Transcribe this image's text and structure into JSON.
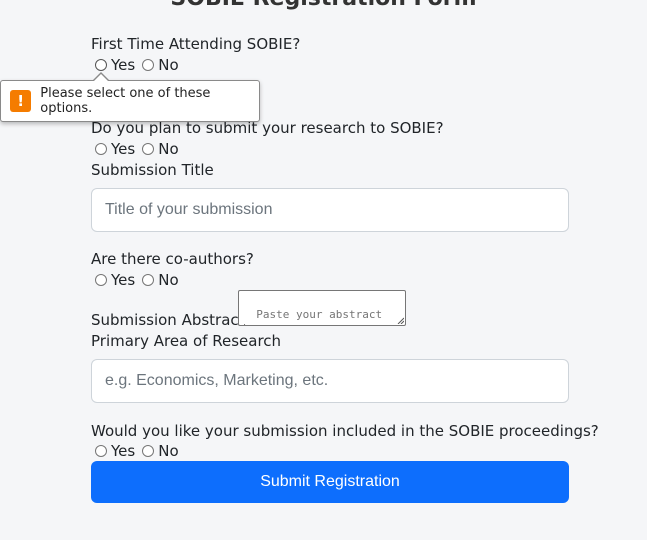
{
  "form": {
    "title": "SOBIE Registration Form",
    "q_first_time": "First Time Attending SOBIE?",
    "q_submit_research": "Do you plan to submit your research to SOBIE?",
    "submission_title_label": "Submission Title",
    "submission_title_placeholder": "Title of your submission",
    "q_coauthors": "Are there co-authors?",
    "abstract_label": "Submission Abstract",
    "abstract_placeholder": "Paste your abstract here...",
    "primary_area_label": "Primary Area of Research",
    "primary_area_placeholder": "e.g. Economics, Marketing, etc.",
    "q_proceedings": "Would you like your submission included in the SOBIE proceedings?",
    "yes": "Yes",
    "no": "No",
    "submit_label": "Submit Registration"
  },
  "validation": {
    "message": "Please select one of these options.",
    "icon": "exclamation-icon",
    "icon_glyph": "!"
  },
  "colors": {
    "primary": "#0d6efd",
    "warning": "#f57c00",
    "background": "#f5f6f8"
  }
}
